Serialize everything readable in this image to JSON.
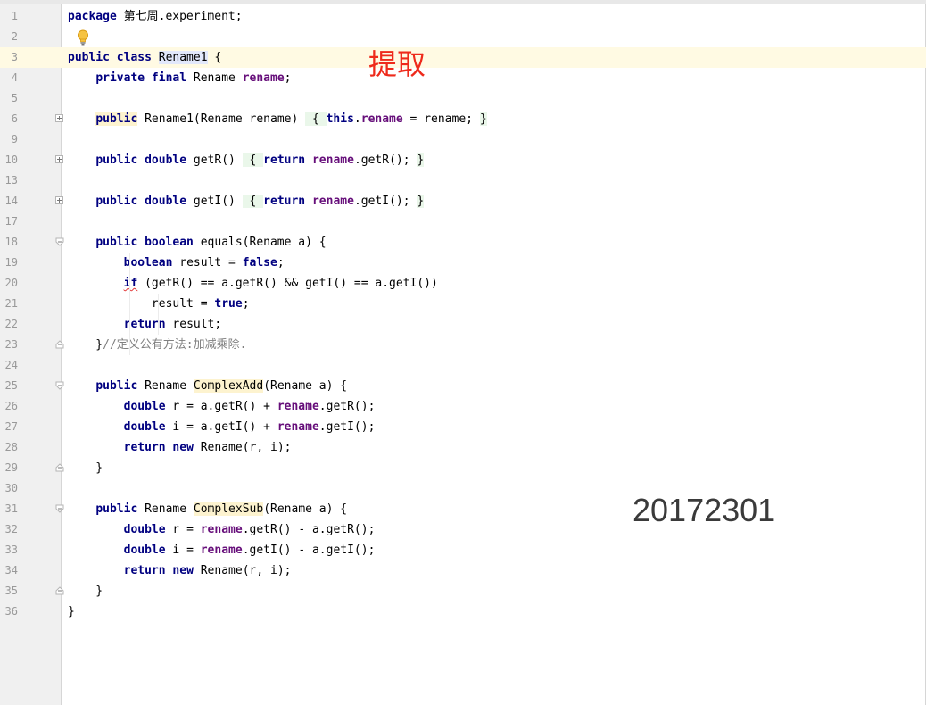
{
  "editor": {
    "annotation_extract": "提取",
    "student_id": "20172301"
  },
  "lines": [
    {
      "n": "1",
      "tokens": [
        {
          "t": "package",
          "c": "kw"
        },
        {
          "t": " 第七周.experiment;"
        }
      ]
    },
    {
      "n": "2",
      "tokens": []
    },
    {
      "n": "3",
      "tokens": [
        {
          "t": "public class",
          "c": "kw"
        },
        {
          "t": " "
        },
        {
          "t": "Rename1",
          "c": "hl-usage"
        },
        {
          "t": " {"
        }
      ]
    },
    {
      "n": "4",
      "tokens": [
        {
          "t": "    "
        },
        {
          "t": "private final",
          "c": "kw"
        },
        {
          "t": " Rename "
        },
        {
          "t": "rename",
          "c": "fld"
        },
        {
          "t": ";"
        }
      ]
    },
    {
      "n": "5",
      "tokens": []
    },
    {
      "n": "6",
      "tokens": [
        {
          "t": "    "
        },
        {
          "t": "public",
          "c": "kw hl-warn"
        },
        {
          "t": " Rename1(Rename rename) "
        },
        {
          "t": " { ",
          "c": "hl-fold"
        },
        {
          "t": "this",
          "c": "kw"
        },
        {
          "t": "."
        },
        {
          "t": "rename",
          "c": "fld"
        },
        {
          "t": " = rename; "
        },
        {
          "t": "}",
          "c": "hl-fold"
        }
      ]
    },
    {
      "n": "9",
      "tokens": []
    },
    {
      "n": "10",
      "tokens": [
        {
          "t": "    "
        },
        {
          "t": "public double",
          "c": "kw"
        },
        {
          "t": " getR() "
        },
        {
          "t": " { ",
          "c": "hl-fold"
        },
        {
          "t": "return",
          "c": "kw"
        },
        {
          "t": " "
        },
        {
          "t": "rename",
          "c": "fld"
        },
        {
          "t": ".getR(); "
        },
        {
          "t": "}",
          "c": "hl-fold"
        }
      ]
    },
    {
      "n": "13",
      "tokens": []
    },
    {
      "n": "14",
      "tokens": [
        {
          "t": "    "
        },
        {
          "t": "public double",
          "c": "kw"
        },
        {
          "t": " getI() "
        },
        {
          "t": " { ",
          "c": "hl-fold"
        },
        {
          "t": "return",
          "c": "kw"
        },
        {
          "t": " "
        },
        {
          "t": "rename",
          "c": "fld"
        },
        {
          "t": ".getI(); "
        },
        {
          "t": "}",
          "c": "hl-fold"
        }
      ]
    },
    {
      "n": "17",
      "tokens": []
    },
    {
      "n": "18",
      "tokens": [
        {
          "t": "    "
        },
        {
          "t": "public boolean",
          "c": "kw"
        },
        {
          "t": " equals(Rename a) {"
        }
      ]
    },
    {
      "n": "19",
      "tokens": [
        {
          "t": "        "
        },
        {
          "t": "boolean",
          "c": "kw"
        },
        {
          "t": " result = "
        },
        {
          "t": "false",
          "c": "kw"
        },
        {
          "t": ";"
        }
      ]
    },
    {
      "n": "20",
      "tokens": [
        {
          "t": "        "
        },
        {
          "t": "if",
          "c": "kw squiggle"
        },
        {
          "t": " (getR() == a.getR() && getI() == a.getI())"
        }
      ]
    },
    {
      "n": "21",
      "tokens": [
        {
          "t": "            result = "
        },
        {
          "t": "true",
          "c": "kw"
        },
        {
          "t": ";"
        }
      ]
    },
    {
      "n": "22",
      "tokens": [
        {
          "t": "        "
        },
        {
          "t": "return",
          "c": "kw"
        },
        {
          "t": " result;"
        }
      ]
    },
    {
      "n": "23",
      "tokens": [
        {
          "t": "    }"
        },
        {
          "t": "//定义公有方法:加减乘除.",
          "c": "cmt"
        }
      ]
    },
    {
      "n": "24",
      "tokens": []
    },
    {
      "n": "25",
      "tokens": [
        {
          "t": "    "
        },
        {
          "t": "public",
          "c": "kw"
        },
        {
          "t": " Rename "
        },
        {
          "t": "ComplexAdd",
          "c": "hl-warn"
        },
        {
          "t": "(Rename a) {"
        }
      ]
    },
    {
      "n": "26",
      "tokens": [
        {
          "t": "        "
        },
        {
          "t": "double",
          "c": "kw"
        },
        {
          "t": " r = a.getR() + "
        },
        {
          "t": "rename",
          "c": "fld"
        },
        {
          "t": ".getR();"
        }
      ]
    },
    {
      "n": "27",
      "tokens": [
        {
          "t": "        "
        },
        {
          "t": "double",
          "c": "kw"
        },
        {
          "t": " i = a.getI() + "
        },
        {
          "t": "rename",
          "c": "fld"
        },
        {
          "t": ".getI();"
        }
      ]
    },
    {
      "n": "28",
      "tokens": [
        {
          "t": "        "
        },
        {
          "t": "return new",
          "c": "kw"
        },
        {
          "t": " Rename(r, i);"
        }
      ]
    },
    {
      "n": "29",
      "tokens": [
        {
          "t": "    }"
        }
      ]
    },
    {
      "n": "30",
      "tokens": []
    },
    {
      "n": "31",
      "tokens": [
        {
          "t": "    "
        },
        {
          "t": "public",
          "c": "kw"
        },
        {
          "t": " Rename "
        },
        {
          "t": "ComplexSub",
          "c": "hl-warn"
        },
        {
          "t": "(Rename a) {"
        }
      ]
    },
    {
      "n": "32",
      "tokens": [
        {
          "t": "        "
        },
        {
          "t": "double",
          "c": "kw"
        },
        {
          "t": " r = "
        },
        {
          "t": "rename",
          "c": "fld"
        },
        {
          "t": ".getR() - a.getR();"
        }
      ]
    },
    {
      "n": "33",
      "tokens": [
        {
          "t": "        "
        },
        {
          "t": "double",
          "c": "kw"
        },
        {
          "t": " i = "
        },
        {
          "t": "rename",
          "c": "fld"
        },
        {
          "t": ".getI() - a.getI();"
        }
      ]
    },
    {
      "n": "34",
      "tokens": [
        {
          "t": "        "
        },
        {
          "t": "return new",
          "c": "kw"
        },
        {
          "t": " Rename(r, i);"
        }
      ]
    },
    {
      "n": "35",
      "tokens": [
        {
          "t": "    }"
        }
      ]
    },
    {
      "n": "36",
      "tokens": [
        {
          "t": "}"
        }
      ]
    }
  ],
  "folds": {
    "6": "plus",
    "10": "plus",
    "14": "plus",
    "18": "open",
    "23": "close",
    "25": "open",
    "29": "close",
    "31": "open",
    "35": "close"
  },
  "caret_line": "3",
  "icons": {
    "intention_bulb": "lightbulb-icon",
    "fold_collapsed": "fold-expand-icon",
    "fold_expanded": "fold-collapse-icon"
  },
  "colors": {
    "keyword": "#000080",
    "field": "#660e7a",
    "comment": "#808080",
    "annotation_text": "#ee2a1b",
    "caret_row": "#fffae3"
  }
}
